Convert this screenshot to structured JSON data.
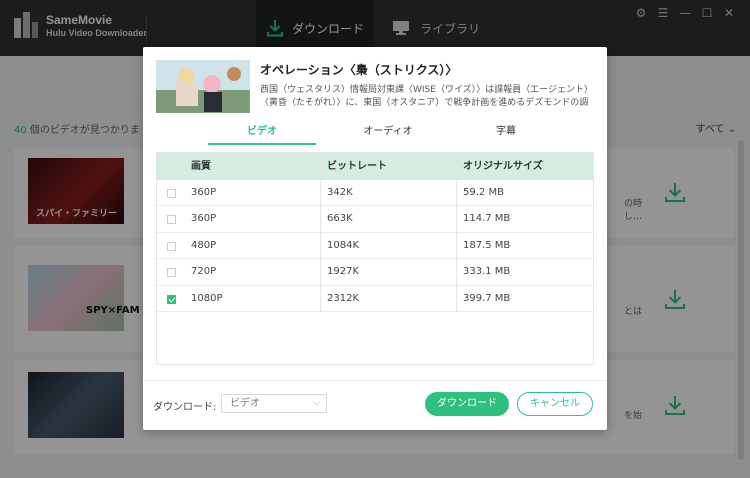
{
  "app": {
    "name": "SameMovie",
    "subtitle": "Hulu Video Downloader"
  },
  "nav": {
    "download_tab": "ダウンロード",
    "library_tab": "ライブラリ"
  },
  "main": {
    "count_number": "40",
    "count_suffix": " 個のビデオが見つかりま",
    "filter": "すべて",
    "rows": [
      {
        "thumb_title": "スパイ・ファミリー",
        "snippet": "の時 し…"
      },
      {
        "thumb_title": "SPY×FAM",
        "snippet": "とは"
      },
      {
        "thumb_title": "",
        "snippet": "を始"
      }
    ]
  },
  "dialog": {
    "title": "オペレーション〈梟（ストリクス）〉",
    "description": "西国（ウェスタリス）情報局対東課〈WISE（ワイズ）〉は諜報員（エージェント）〈黄昏（たそがれ）〉に、東国（オスタニア）で戦争計画を進めるデズモンドの調査を命じる。〈...",
    "tabs": [
      "ビデオ",
      "オーディオ",
      "字幕"
    ],
    "active_tab": "ビデオ",
    "table": {
      "headers": [
        "画質",
        "ビットレート",
        "オリジナルサイズ"
      ],
      "rows": [
        {
          "quality": "360P",
          "bitrate": "342K",
          "size": "59.2 MB",
          "checked": false
        },
        {
          "quality": "360P",
          "bitrate": "663K",
          "size": "114.7 MB",
          "checked": false
        },
        {
          "quality": "480P",
          "bitrate": "1084K",
          "size": "187.5 MB",
          "checked": false
        },
        {
          "quality": "720P",
          "bitrate": "1927K",
          "size": "333.1 MB",
          "checked": false
        },
        {
          "quality": "1080P",
          "bitrate": "2312K",
          "size": "399.7 MB",
          "checked": true
        }
      ]
    },
    "footer": {
      "download_label": "ダウンロード:",
      "select_value": "ビデオ",
      "download_button": "ダウンロード",
      "cancel_button": "キャンセル"
    }
  },
  "colors": {
    "accent": "#2ec17d",
    "titlebar": "#2e3135",
    "table_header": "#d5ede1"
  }
}
